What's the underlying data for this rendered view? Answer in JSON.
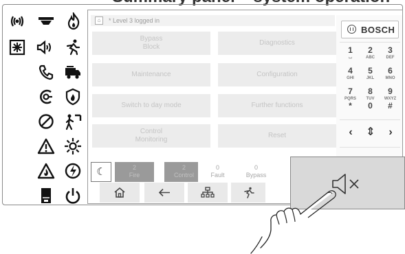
{
  "header": {
    "title": "Summary panel – system operation"
  },
  "status_bar": {
    "text": "* Level 3 logged in"
  },
  "menu": {
    "bypass_block": "Bypass\nBlock",
    "diagnostics": "Diagnostics",
    "maintenance": "Maintenance",
    "configuration": "Configuration",
    "day_mode": "Switch to day mode",
    "further_functions": "Further functions",
    "control_monitoring": "Control\nMonitoring",
    "reset": "Reset"
  },
  "brand": {
    "name": "BOSCH"
  },
  "keypad": {
    "keys": [
      {
        "num": "1",
        "sub": "⌴"
      },
      {
        "num": "2",
        "sub": "ABC"
      },
      {
        "num": "3",
        "sub": "DEF"
      },
      {
        "num": "4",
        "sub": "GHI"
      },
      {
        "num": "5",
        "sub": "JKL"
      },
      {
        "num": "6",
        "sub": "MNO"
      },
      {
        "num": "7",
        "sub": "PQRS"
      },
      {
        "num": "8",
        "sub": "TUV"
      },
      {
        "num": "9",
        "sub": "WXYZ"
      },
      {
        "num": "*",
        "sub": ""
      },
      {
        "num": "0",
        "sub": ""
      },
      {
        "num": "#",
        "sub": ""
      }
    ],
    "left": "‹",
    "updown": "⇕",
    "right": "›",
    "enter": "↵"
  },
  "counters": {
    "fire": {
      "count": "2",
      "label": "Fire"
    },
    "control": {
      "count": "2",
      "label": "Control"
    },
    "fault": {
      "count": "0",
      "label": "Fault"
    },
    "bypass": {
      "count": "0",
      "label": "Bypass"
    }
  },
  "colors": {
    "counter_active": "#9a9a9a",
    "button_bg": "#ececec",
    "button_text": "#c4c4c4"
  }
}
